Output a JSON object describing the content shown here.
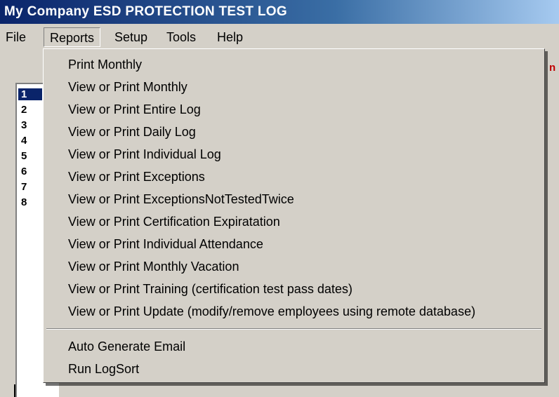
{
  "window": {
    "title": "My Company ESD PROTECTION TEST LOG"
  },
  "menubar": {
    "items": [
      {
        "label": "File"
      },
      {
        "label": "Reports"
      },
      {
        "label": "Setup"
      },
      {
        "label": "Tools"
      },
      {
        "label": "Help"
      }
    ]
  },
  "background": {
    "partial_header_char": "n",
    "row_numbers": [
      "1",
      "2",
      "3",
      "4",
      "5",
      "6",
      "7",
      "8"
    ]
  },
  "reports_menu": {
    "items": [
      "Print Monthly",
      "View or Print Monthly",
      "View or Print Entire Log",
      "View or Print Daily Log",
      "View or Print Individual Log",
      "View or Print Exceptions",
      "View or Print ExceptionsNotTestedTwice",
      "View or Print Certification Expiratation",
      "View or Print Individual Attendance",
      "View or Print Monthly Vacation",
      "View or Print Training (certification test pass dates)",
      "View or Print Update (modify/remove employees using remote database)"
    ],
    "extra_items": [
      "Auto Generate Email",
      "Run LogSort"
    ]
  },
  "colors": {
    "title_bar": "#0a246a",
    "face": "#d4d0c8",
    "accent_red": "#c00000"
  }
}
